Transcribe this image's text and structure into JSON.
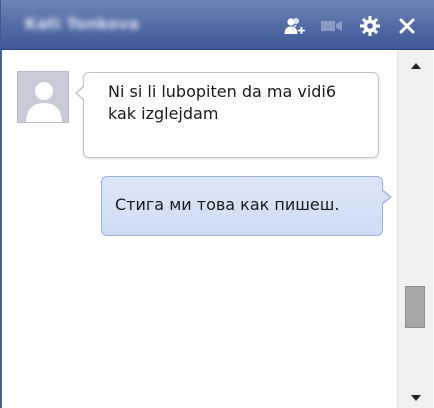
{
  "window": {
    "contact_name": "Kati Tonkova"
  },
  "titlebar": {
    "icons": [
      "add-friend-icon",
      "video-call-icon",
      "gear-icon",
      "close-icon"
    ],
    "color_top": "#6d84b4",
    "color_bottom": "#3b5998"
  },
  "messages": [
    {
      "direction": "incoming",
      "text": "Ni si li lubopiten da ma vidi6 kak izglejdam",
      "avatar": "default-profile-icon"
    },
    {
      "direction": "outgoing",
      "text": "Стига ми това как пишеш."
    }
  ],
  "colors": {
    "outgoing_bubble": "#d6e1f6",
    "outgoing_border": "#9db0d6",
    "incoming_bubble": "#ffffff"
  }
}
